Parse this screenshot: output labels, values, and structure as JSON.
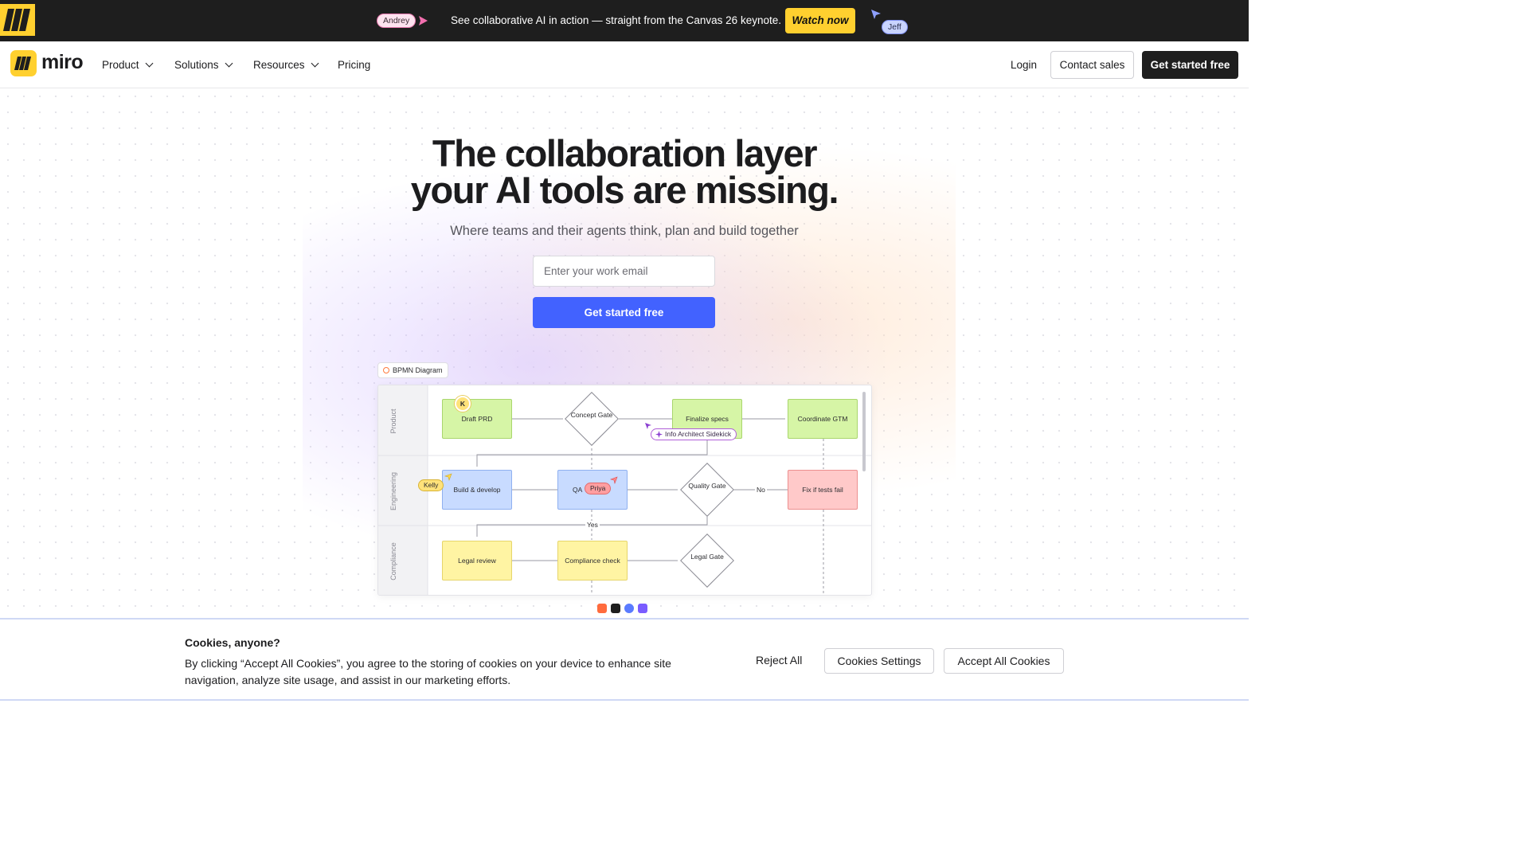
{
  "promo": {
    "cursor_andrey": "Andrey",
    "cursor_jeff": "Jeff",
    "text": "See collaborative AI in action — straight from the Canvas 26 keynote.",
    "watch_label": "Watch now",
    "brand_color": "#ffd02f"
  },
  "nav": {
    "brand": "miro",
    "items": [
      {
        "label": "Product",
        "has_dropdown": true,
        "icon": "chevron-down-icon"
      },
      {
        "label": "Solutions",
        "has_dropdown": true,
        "icon": "chevron-down-icon"
      },
      {
        "label": "Resources",
        "has_dropdown": true,
        "icon": "chevron-down-icon"
      },
      {
        "label": "Pricing",
        "has_dropdown": false
      }
    ],
    "login": "Login",
    "contact_sales": "Contact sales",
    "get_started": "Get started free"
  },
  "hero": {
    "headline_line1": "The collaboration layer",
    "headline_line2": "your AI tools are missing.",
    "subhead": "Where teams and their agents think, plan and build together",
    "email_placeholder": "Enter your work email",
    "cta": "Get started free",
    "cta_color": "#4262ff"
  },
  "diagram": {
    "tag": "BPMN Diagram",
    "lanes": [
      "Product",
      "Engineering",
      "Compliance"
    ],
    "nodes": {
      "draft_prd": "Draft PRD",
      "concept_gate": "Concept Gate",
      "finalize_specs": "Finalize specs",
      "coordinate_gtm": "Coordinate GTM",
      "build_develop": "Build & develop",
      "qa": "QA",
      "quality_gate": "Quality Gate",
      "fix_tests": "Fix if tests fail",
      "legal_review": "Legal review",
      "compliance_check": "Compliance check",
      "legal_gate": "Legal Gate"
    },
    "edge_labels": {
      "no": "No",
      "yes": "Yes"
    },
    "collaborators": {
      "avatar_k": "K",
      "kelly": "Kelly",
      "priya": "Priya",
      "sidekick": "Info Architect Sidekick"
    }
  },
  "cookie": {
    "title": "Cookies, anyone?",
    "text": "By clicking “Accept All Cookies”, you agree to the storing of cookies on your device to enhance site navigation, analyze site usage, and assist in our marketing efforts.",
    "reject": "Reject All",
    "settings": "Cookies Settings",
    "accept": "Accept All Cookies"
  }
}
